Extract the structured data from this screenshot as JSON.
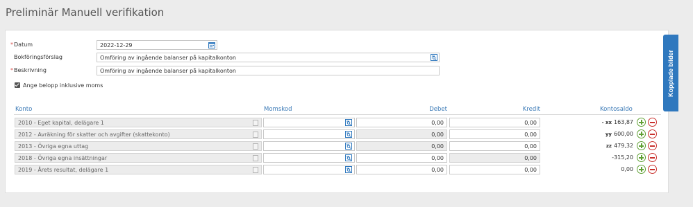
{
  "page": {
    "title": "Preliminär Manuell verifikation"
  },
  "form": {
    "datum_label": "Datum",
    "datum_value": "2022-12-29",
    "bokf_label": "Bokföringsförslag",
    "bokf_value": "Omföring av ingående balanser på kapitalkonton",
    "beskr_label": "Beskrivning",
    "beskr_value": "Omföring av ingående balanser på kapitalkonton",
    "moms_checkbox_label": "Ange belopp inklusive moms",
    "moms_checked": true
  },
  "table": {
    "headers": {
      "konto": "Konto",
      "momskod": "Momskod",
      "debet": "Debet",
      "kredit": "Kredit",
      "kontosaldo": "Kontosaldo"
    },
    "rows": [
      {
        "konto": "2010 - Eget kapital, delägare 1",
        "debet": "0,00",
        "kredit": "0,00",
        "saldo_prefix": "- xx",
        "saldo": "163,87"
      },
      {
        "konto": "2012 - Avräkning för skatter och avgifter (skattekonto)",
        "debet": "0,00",
        "kredit": "0,00",
        "saldo_prefix": "yy",
        "saldo": "600,00"
      },
      {
        "konto": "2013 - Övriga egna uttag",
        "debet": "0,00",
        "kredit": "0,00",
        "saldo_prefix": "zz",
        "saldo": "479,32"
      },
      {
        "konto": "2018 - Övriga egna insättningar",
        "debet": "0,00",
        "kredit": "0,00",
        "saldo_prefix": "",
        "saldo": "-315,20"
      },
      {
        "konto": "2019 - Årets resultat, delägare 1",
        "debet": "0,00",
        "kredit": "0,00",
        "saldo_prefix": "",
        "saldo": "0,00"
      }
    ]
  },
  "side_tab": {
    "label": "Kopplade bilder"
  },
  "colors": {
    "accent": "#2f78be",
    "header_text": "#3a79b6",
    "required": "#d9534f",
    "add": "#5fa033",
    "remove": "#c9302c"
  },
  "icons": {
    "calendar": "calendar-icon",
    "lookup": "search-list-icon",
    "add": "plus-circle-icon",
    "remove": "minus-circle-icon"
  }
}
